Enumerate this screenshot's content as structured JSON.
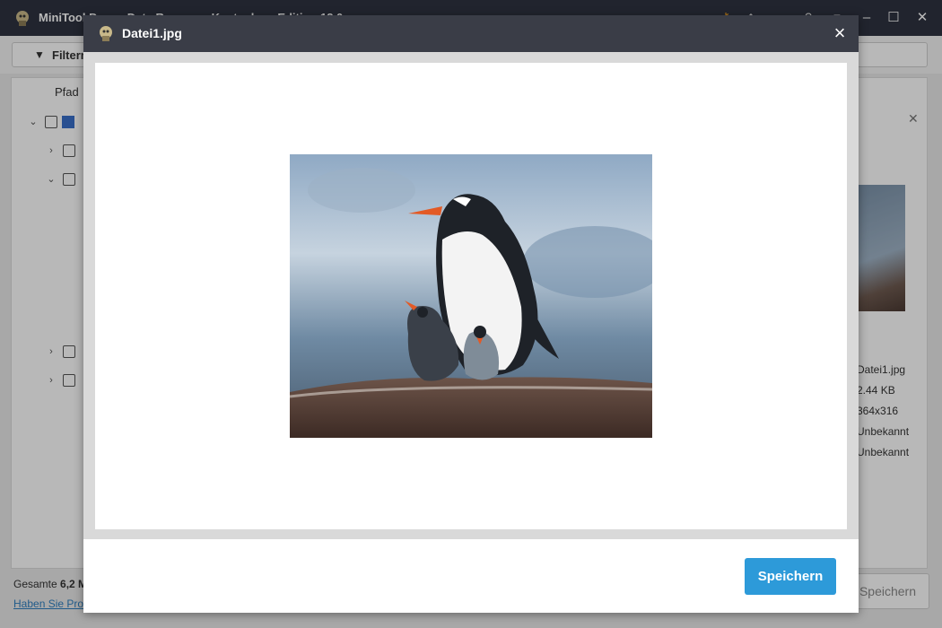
{
  "app": {
    "title": "MiniTool Power Data Recovery Kostenlose Edition 12.0"
  },
  "toolbar": {
    "filter_label": "Filtern"
  },
  "tree": {
    "column_header": "Pfad"
  },
  "preview_panel": {
    "properties": [
      "Datei1.jpg",
      "2.44 KB",
      "364x316",
      "Unbekannt",
      "Unbekannt"
    ]
  },
  "status": {
    "total_prefix": "Gesamte ",
    "total_value": "6,2 M",
    "help_link": "Haben Sie Pro"
  },
  "background": {
    "save_label": "Speichern"
  },
  "dialog": {
    "title": "Datei1.jpg",
    "close_symbol": "×",
    "save_label": "Speichern"
  },
  "colors": {
    "accent": "#2d9ad9",
    "titlebar": "#3a3d47"
  }
}
